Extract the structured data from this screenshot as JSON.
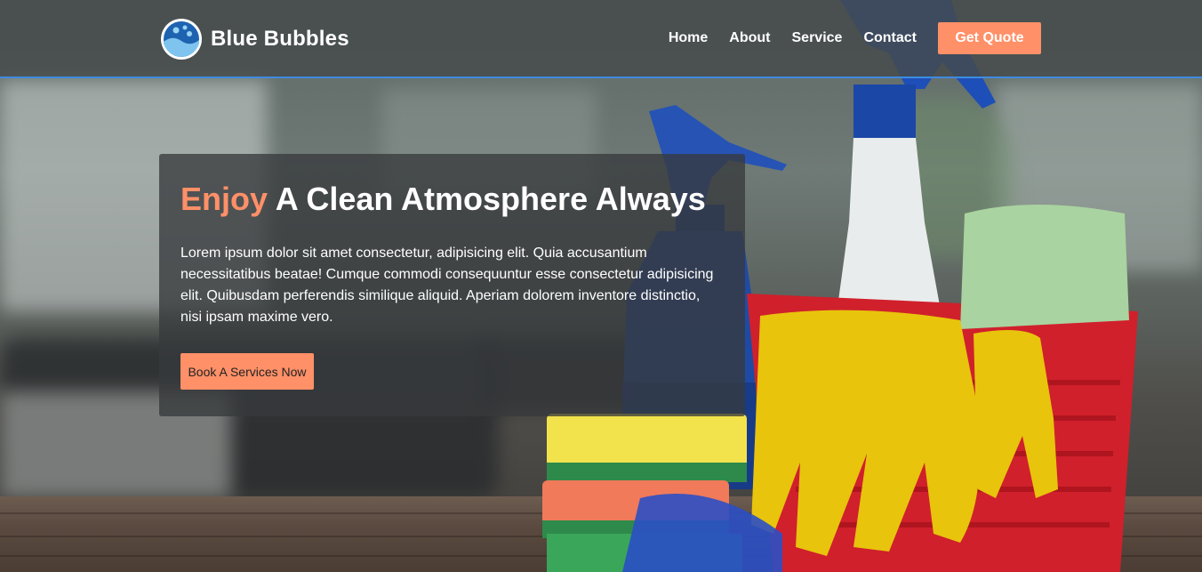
{
  "header": {
    "brand": "Blue Bubbles",
    "nav": [
      {
        "label": "Home"
      },
      {
        "label": "About"
      },
      {
        "label": "Service"
      },
      {
        "label": "Contact"
      }
    ],
    "cta_label": "Get Quote"
  },
  "hero": {
    "title_accent": "Enjoy",
    "title_rest": "A Clean Atmosphere Always",
    "description": "Lorem ipsum dolor sit amet consectetur, adipisicing elit. Quia accusantium necessitatibus beatae! Cumque commodi consequuntur esse consectetur adipisicing elit. Quibusdam perferendis similique aliquid. Aperiam dolorem inventore distinctio, nisi ipsam maxime vero.",
    "button_label": "Book A Services Now"
  },
  "colors": {
    "accent": "#ff9068",
    "header_border": "#3d8be0",
    "logo_blue": "#1e63b0"
  },
  "icons": {
    "logo": "bubbles-logo-icon"
  }
}
